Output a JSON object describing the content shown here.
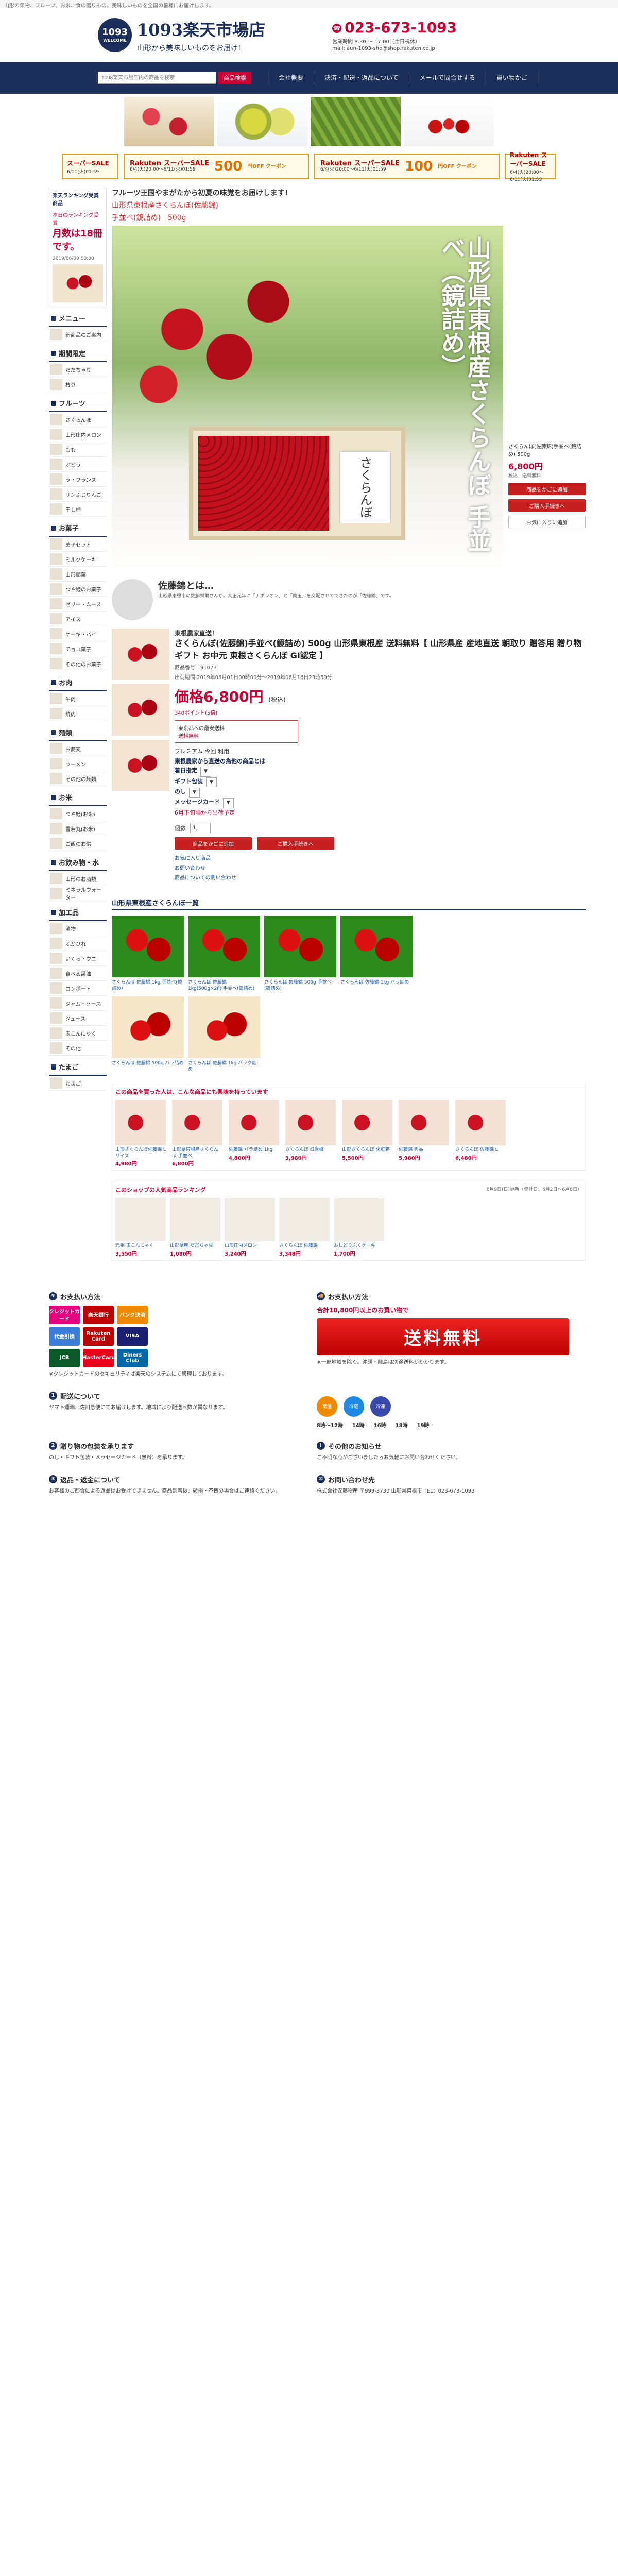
{
  "top_strip": "山形の果物、フルーツ、お米、食の贈りもの。美味しいものを全国の皆様にお届けします。",
  "header": {
    "logo_num": "1093",
    "logo_sub": "楽天市場店",
    "logo_name": "1093楽天市場店",
    "tagline": "山形から美味しいものをお届け!",
    "phone": "023-673-1093",
    "hours": "営業時間 8:30 〜 17:00（土日祝休）",
    "mail": "mail: aun-1093-sho@shop.rakuten.co.jp"
  },
  "nav": {
    "search_placeholder": "1093楽天市場店内の商品を検索",
    "search_button": "商品検索",
    "items": [
      "会社概要",
      "決済・配送・返品について",
      "メールで問合せする",
      "買い物かご"
    ]
  },
  "coupons": [
    {
      "brand": "スーパーSALE",
      "date": "6/11(火)01:59",
      "amount": "",
      "off": ""
    },
    {
      "brand": "Rakuten スーパーSALE",
      "date": "6/4(火)20:00〜6/11(火)01:59",
      "amount": "500",
      "off": "円OFF クーポン"
    },
    {
      "brand": "Rakuten スーパーSALE",
      "date": "6/4(火)20:00〜6/11(火)01:59",
      "amount": "100",
      "off": "円OFF クーポン"
    },
    {
      "brand": "Rakuten スーパーSALE",
      "date": "6/4(火)20:00〜6/11(火)01:59",
      "amount": "",
      "off": ""
    }
  ],
  "sidebar": {
    "rank_hd": "楽天ランキング受賞商品",
    "rank_lbl": "本日のランキング受賞",
    "rank_big": "月数は18冊です。",
    "rank_date": "2019/06/09 00:00",
    "menu_hd": "メニュー",
    "menu_items": [
      "新商品のご案内"
    ],
    "season_hd": "期間限定",
    "season_items": [
      "だだちゃ豆",
      "枝豆"
    ],
    "fruit_hd": "フルーツ",
    "fruit_items": [
      "さくらんぼ",
      "山形庄内メロン",
      "もも",
      "ぶどう",
      "ラ・フランス",
      "サンふじりんご",
      "干し柿"
    ],
    "sweets_hd": "お菓子",
    "sweets_items": [
      "菓子セット",
      "ミルクケーキ",
      "山形銘菓",
      "つや姫のお菓子",
      "ゼリー・ムース",
      "アイス",
      "ケーキ・パイ",
      "チョコ菓子",
      "その他のお菓子"
    ],
    "meat_hd": "お肉",
    "meat_items": [
      "牛肉",
      "焼肉"
    ],
    "noodle_hd": "麺類",
    "noodle_items": [
      "お蕎麦",
      "ラーメン",
      "その他の麺類"
    ],
    "rice_hd": "お米",
    "rice_items": [
      "つや姫(お米)",
      "雪若丸(お米)",
      "ご飯のお供"
    ],
    "drink_hd": "お飲み物・水",
    "drink_items": [
      "山形のお酒類",
      "ミネラルウォーター"
    ],
    "processed_hd": "加工品",
    "processed_items": [
      "漬物",
      "ふかひれ",
      "いくら・ウニ",
      "食べる醤油",
      "コンポート",
      "ジャム・ソース",
      "ジュース",
      "玉こんにゃく",
      "その他"
    ],
    "egg_hd": "たまご",
    "egg_items": [
      "たまご"
    ]
  },
  "product": {
    "headline": "フルーツ王国やまがたから初夏の味覚をお届けします！",
    "subhead1": "山形県東根産さくらんぼ(佐藤錦)",
    "subhead2": "手並べ(鏡詰め)　500g",
    "hero_title": "山形県東根産さくらんぼ 手並べ（鏡詰め）",
    "box_label": "さくらんぼ",
    "panel_name": "さくらんぼ(佐藤錦)手並べ(鏡詰め) 500g",
    "panel_price": "6,800円",
    "panel_tax": "税込　送料無料",
    "add_cart": "商品をかごに追加",
    "buy_now": "ご購入手続きへ",
    "wishlist": "お気に入りに追加",
    "desc_person": "佐藤錦とは…",
    "desc_intro": "山形県東根市の佐藤栄助さんが、大正元年に「ナポレオン」と「黄玉」を交配させてできたのが「佐藤錦」です。",
    "detail_label": "東根農家直送！",
    "detail_title": "さくらんぼ(佐藤錦)手並べ(鏡詰め) 500g 山形県東根産 送料無料【 山形県産 産地直送 朝取り 贈答用 贈り物 ギフト お中元 東根さくらんぼ GI認定 】",
    "item_no": "商品番号　91073",
    "ship_period": "出荷期間 2019年06月01日00時00分〜2019年06月16日23時59分",
    "price": "価格6,800円",
    "price_tax": "(税込)",
    "points": "340ポイント(5倍)",
    "sm_title": "東京都への最安送料",
    "sm_body": "送料無料",
    "option_hd": "プレミアム 今回 利用",
    "opt1": "東根農家から直送の為他の商品とは",
    "opt2": "着日指定",
    "opt3": "ギフト包装",
    "opt4": "のし",
    "opt5": "メッセージカード",
    "opt6": "6月下旬頃から出荷予定",
    "qty_label": "個数",
    "qty_value": "1",
    "btn_cart": "商品をかごに追加",
    "btn_buy": "ご購入手続きへ",
    "links": [
      "お気に入り商品",
      "お問い合わせ",
      "商品についての問い合わせ"
    ]
  },
  "list_title": "山形県東根産さくらんぼ一覧",
  "items": [
    "さくらんぼ 佐藤錦 1kg 手並べ(鏡詰め)",
    "さくらんぼ 佐藤錦 1kg(500g×2P) 手並べ(鏡詰め)",
    "さくらんぼ 佐藤錦 500g 手並べ(鏡詰め)",
    "さくらんぼ 佐藤錦 1kg バラ詰め",
    "さくらんぼ 佐藤錦 500g バラ詰め",
    "さくらんぼ 佐藤錦 1kg パック詰め"
  ],
  "related": {
    "title": "この商品を買った人は、こんな商品にも興味を持っています",
    "cards": [
      {
        "name": "山形さくらんぼ佐藤錦 Lサイズ",
        "price": "4,980円"
      },
      {
        "name": "山形県東根産さくらんぼ 手並べ",
        "price": "6,800円"
      },
      {
        "name": "佐藤錦 バラ詰め 1kg",
        "price": "4,800円"
      },
      {
        "name": "さくらんぼ 紅秀峰",
        "price": "3,980円"
      },
      {
        "name": "山形さくらんぼ 化粧箱",
        "price": "5,500円"
      },
      {
        "name": "佐藤錦 秀品",
        "price": "5,980円"
      },
      {
        "name": "さくらんぼ 佐藤錦 L",
        "price": "6,480円"
      }
    ]
  },
  "ranking": {
    "title": "このショップの人気商品ランキング",
    "period": "6月9日(日)更新（集計日：6月2日〜6月8日）",
    "cards": [
      {
        "name": "元祖 玉こんにゃく",
        "price": "3,550円"
      },
      {
        "name": "山形県産 だだちゃ豆",
        "price": "1,080円"
      },
      {
        "name": "山形庄内メロン",
        "price": "3,240円"
      },
      {
        "name": "さくらんぼ 佐藤錦",
        "price": "3,348円"
      },
      {
        "name": "おしどりふくケーキ",
        "price": "1,700円"
      }
    ]
  },
  "info": {
    "payment_hd": "お支払い方法",
    "payment_items": [
      "クレジットカード",
      "楽天銀行",
      "バンク決済",
      "代金引換",
      "Rakuten Card",
      "VISA",
      "JCB",
      "MasterCard",
      "Diners Club"
    ],
    "payment_note": "※クレジットカードのセキュリティは楽天のシステムにて管理しております。",
    "shipping_hd": "お支払い方法",
    "ship_note": "合計10,800円以上のお買い物で",
    "free_ship": "送料無料",
    "ship_body": "※一部地域を除く。沖縄・離島は別途送料がかかります。",
    "delivery_hd": "配送について",
    "delivery_body": "ヤマト運輸、佐川急便にてお届けします。地域により配送日数が異なります。",
    "temps": [
      "常温",
      "冷蔵",
      "冷凍"
    ],
    "times": [
      "8時〜12時",
      "14時",
      "16時",
      "18時",
      "19時"
    ],
    "gift_hd": "贈り物の包装を承ります",
    "gift_body": "のし・ギフト包装・メッセージカード（無料）を承ります。",
    "return_hd": "返品・返金について",
    "return_body": "お客様のご都合による返品はお受けできません。商品到着後、破損・不良の場合はご連絡ください。",
    "other_hd": "その他のお知らせ",
    "other_body": "ご不明な点がございましたらお気軽にお問い合わせください。",
    "contact_hd": "お問い合わせ先",
    "contact_body": "株式会社安藤物産 〒999-3730 山形県東根市 TEL：023-673-1093"
  }
}
